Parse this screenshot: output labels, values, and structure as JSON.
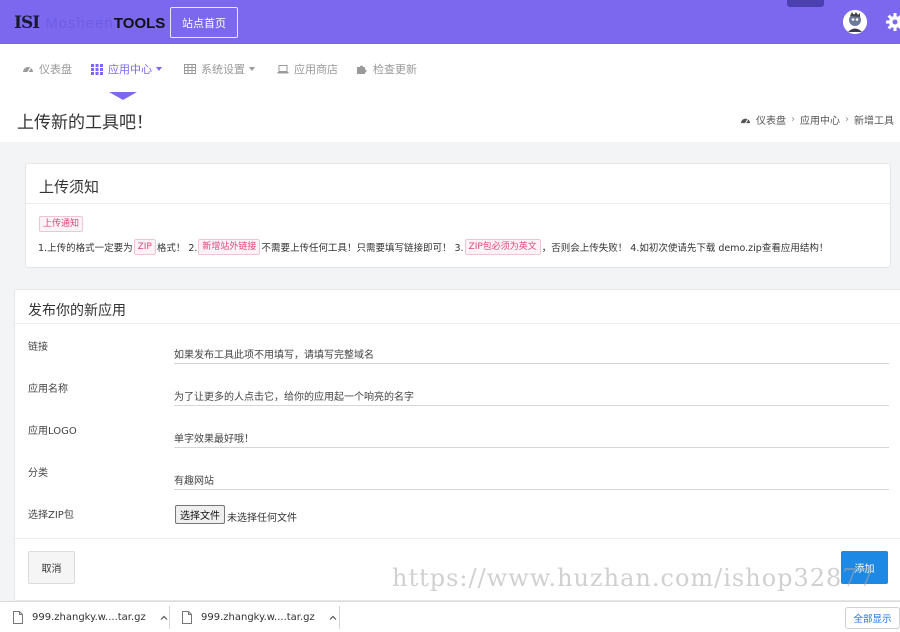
{
  "header": {
    "logo_mark": "ISI",
    "logo_faded": "Mosheen",
    "logo_bold": "TOOLS",
    "home_button": "站点首页"
  },
  "nav": {
    "items": [
      {
        "label": "仪表盘",
        "icon": "dashboard-icon"
      },
      {
        "label": "应用中心",
        "icon": "grid-icon",
        "active": true
      },
      {
        "label": "系统设置",
        "icon": "table-icon"
      },
      {
        "label": "应用商店",
        "icon": "laptop-icon"
      },
      {
        "label": "检查更新",
        "icon": "puzzle-icon"
      }
    ]
  },
  "page": {
    "title": "上传新的工具吧！",
    "breadcrumb": [
      "仪表盘",
      "应用中心",
      "新增工具"
    ]
  },
  "notice": {
    "title": "上传须知",
    "tag": "上传通知",
    "part1": "1.上传的格式一定要为",
    "tag_zip": "ZIP",
    "part2": "格式！ 2.",
    "tag_link": "新增站外链接",
    "part3": "不需要上传任何工具！只需要填写链接即可！ 3.",
    "tag_en": "ZIP包必须为英文",
    "part4": "，否则会上传失败！ 4.如初次使请先下载 demo.zip查看应用结构！"
  },
  "form": {
    "title": "发布你的新应用",
    "fields": [
      {
        "label": "链接",
        "placeholder": "如果发布工具此项不用填写，请填写完整域名"
      },
      {
        "label": "应用名称",
        "placeholder": "为了让更多的人点击它，给你的应用起一个响亮的名字"
      },
      {
        "label": "应用LOGO",
        "placeholder": "单字效果最好哦！"
      },
      {
        "label": "分类",
        "value": "有趣网站"
      }
    ],
    "zip_label": "选择ZIP包",
    "file_button": "选择文件",
    "file_status": "未选择任何文件",
    "cancel": "取消",
    "submit": "添加"
  },
  "watermark": "https://www.huzhan.com/ishop32877",
  "downloads": {
    "items": [
      "999.zhangky.w....tar.gz",
      "999.zhangky.w....tar.gz"
    ],
    "show_all": "全部显示"
  },
  "colors": {
    "primary": "#7b68ee",
    "submit": "#1e88e5",
    "tag_text": "#e0457b"
  }
}
